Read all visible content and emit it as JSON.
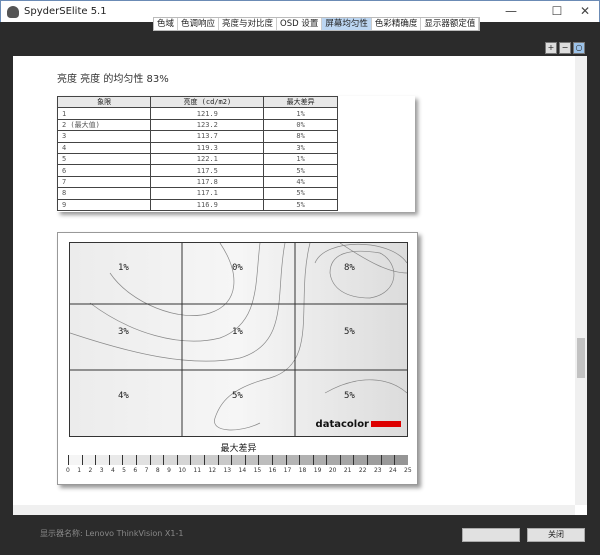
{
  "window": {
    "title": "SpyderSElite 5.1",
    "minimize": "—",
    "maximize": "☐",
    "close": "✕"
  },
  "tabs": [
    {
      "label": "色域"
    },
    {
      "label": "色调响应"
    },
    {
      "label": "亮度与对比度"
    },
    {
      "label": "OSD 设置"
    },
    {
      "label": "屏幕均匀性",
      "active": true
    },
    {
      "label": "色彩精确度"
    },
    {
      "label": "显示器额定值"
    }
  ],
  "zoom": {
    "in": "+",
    "out": "−",
    "fit": "○"
  },
  "report": {
    "heading": "亮度 亮度 的均匀性 83%",
    "table": {
      "headers": [
        "象限",
        "亮度 (cd/m2)",
        "最大差异"
      ],
      "rows": [
        [
          "1",
          "121.9",
          "1%"
        ],
        [
          "2 (最大值)",
          "123.2",
          "0%"
        ],
        [
          "3",
          "113.7",
          "8%"
        ],
        [
          "4",
          "119.3",
          "3%"
        ],
        [
          "5",
          "122.1",
          "1%"
        ],
        [
          "6",
          "117.5",
          "5%"
        ],
        [
          "7",
          "117.8",
          "4%"
        ],
        [
          "8",
          "117.1",
          "5%"
        ],
        [
          "9",
          "116.9",
          "5%"
        ]
      ]
    },
    "map": {
      "cells": [
        "1%",
        "0%",
        "8%",
        "3%",
        "1%",
        "5%",
        "4%",
        "5%",
        "5%"
      ],
      "logo": "datacolor"
    },
    "legend": {
      "title": "最大差异",
      "labels": [
        "0",
        "1",
        "2",
        "3",
        "4",
        "5",
        "6",
        "7",
        "8",
        "9",
        "10",
        "11",
        "12",
        "13",
        "14",
        "15",
        "16",
        "17",
        "18",
        "19",
        "20",
        "21",
        "22",
        "23",
        "24",
        "25"
      ]
    }
  },
  "footer": {
    "device_name": "显示器名称: Lenovo ThinkVision X1-1",
    "close": "关闭"
  }
}
